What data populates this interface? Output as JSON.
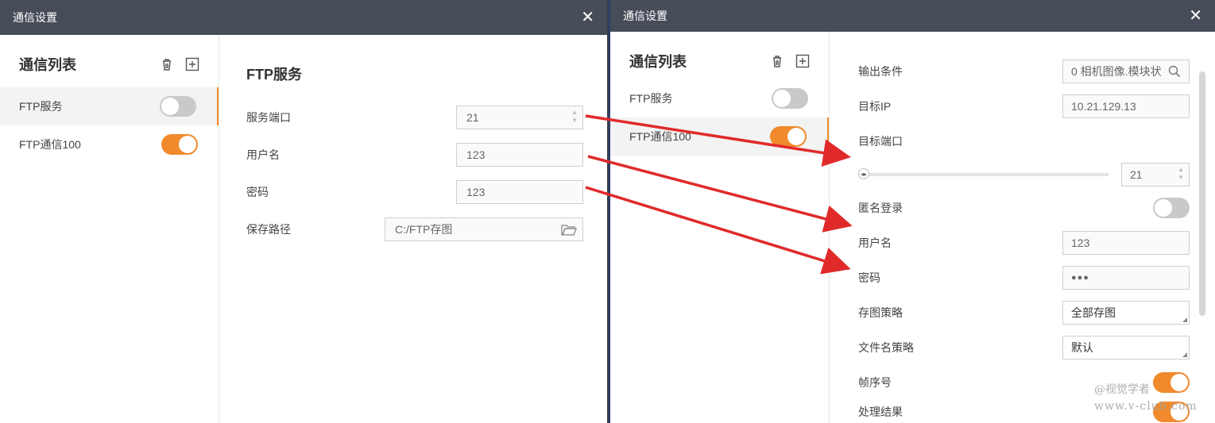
{
  "dialogA": {
    "title": "通信设置",
    "list": {
      "heading": "通信列表",
      "items": [
        {
          "label": "FTP服务",
          "enabled": false
        },
        {
          "label": "FTP通信100",
          "enabled": true
        }
      ]
    },
    "form": {
      "title": "FTP服务",
      "port_label": "服务端口",
      "port_value": "21",
      "username_label": "用户名",
      "username_value": "123",
      "password_label": "密码",
      "password_value": "123",
      "path_label": "保存路径",
      "path_value": "C:/FTP存图"
    }
  },
  "dialogB": {
    "title": "通信设置",
    "list": {
      "heading": "通信列表",
      "items": [
        {
          "label": "FTP服务",
          "enabled": false
        },
        {
          "label": "FTP通信100",
          "enabled": true
        }
      ]
    },
    "form": {
      "output_cond_label": "输出条件",
      "output_cond_value": "0 相机图像.模块状",
      "target_ip_label": "目标IP",
      "target_ip_value": "10.21.129.13",
      "target_port_label": "目标端口",
      "target_port_value": "21",
      "anonymous_label": "匿名登录",
      "anonymous_enabled": false,
      "username_label": "用户名",
      "username_value": "123",
      "password_label": "密码",
      "password_value": "●●●",
      "save_policy_label": "存图策略",
      "save_policy_value": "全部存图",
      "filename_policy_label": "文件名策略",
      "filename_policy_value": "默认",
      "frame_seq_label": "帧序号",
      "frame_seq_enabled": true,
      "process_result_label": "处理结果"
    }
  },
  "watermark": {
    "line1": "@视觉学者",
    "line2": "www.v-club.com"
  },
  "colors": {
    "accent": "#f08a2c",
    "titlebar": "#474c59",
    "arrow": "#e02a2a"
  }
}
